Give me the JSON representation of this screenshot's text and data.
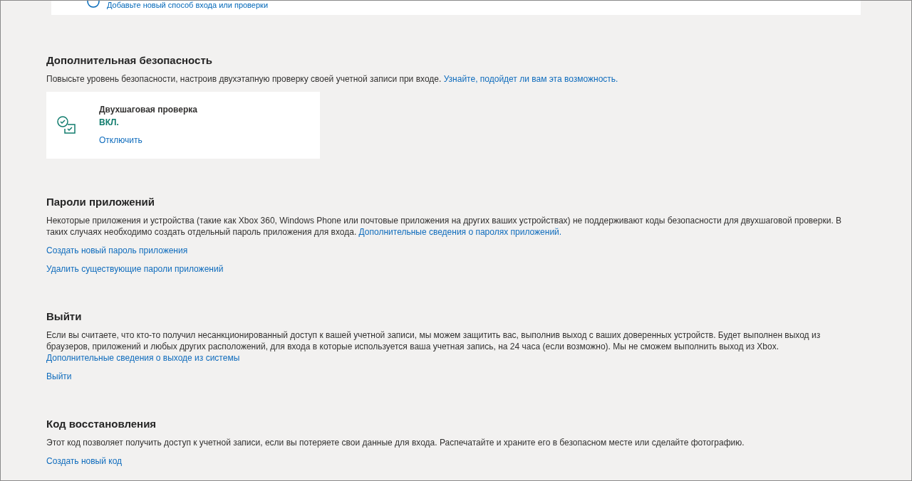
{
  "top_card": {
    "link": "Добавьте новый способ входа или проверки"
  },
  "sections": [
    {
      "kind": "status",
      "title": "Дополнительная безопасность",
      "text": "Повысьте уровень безопасности, настроив двухэтапную проверку своей учетной записи при входе.",
      "link": "Узнайте, подойдет ли вам эта возможность.",
      "card": {
        "title": "Двухшаговая проверка",
        "on": true,
        "status": "ВКЛ.",
        "action": "Отключить"
      }
    },
    {
      "kind": "links",
      "title": "Пароли приложений",
      "text": "Некоторые приложения и устройства (такие как Xbox 360, Windows Phone или почтовые приложения на других ваших устройствах) не поддерживают коды безопасности для двухшаговой проверки. В таких случаях необходимо создать отдельный пароль приложения для входа.",
      "link": "Дополнительные сведения о паролях приложений.",
      "actions": [
        "Создать новый пароль приложения",
        "Удалить существующие пароли приложений"
      ]
    },
    {
      "kind": "links",
      "title": "Выйти",
      "text": "Если вы считаете, что кто-то получил несанкционированный доступ к вашей учетной записи, мы можем защитить вас, выполнив выход с ваших доверенных устройств. Будет выполнен выход из браузеров, приложений и любых других расположений, для входа в которые используется ваша учетная запись, на 24 часа (если возможно). Мы не сможем выполнить выход из Xbox.",
      "link": "Дополнительные сведения о выходе из системы",
      "actions": [
        "Выйти"
      ]
    },
    {
      "kind": "links",
      "title": "Код восстановления",
      "text": "Этот код позволяет получить доступ к учетной записи, если вы потеряете свои данные для входа. Распечатайте и храните его в безопасном месте или сделайте фотографию.",
      "actions": [
        "Создать новый код"
      ]
    }
  ]
}
